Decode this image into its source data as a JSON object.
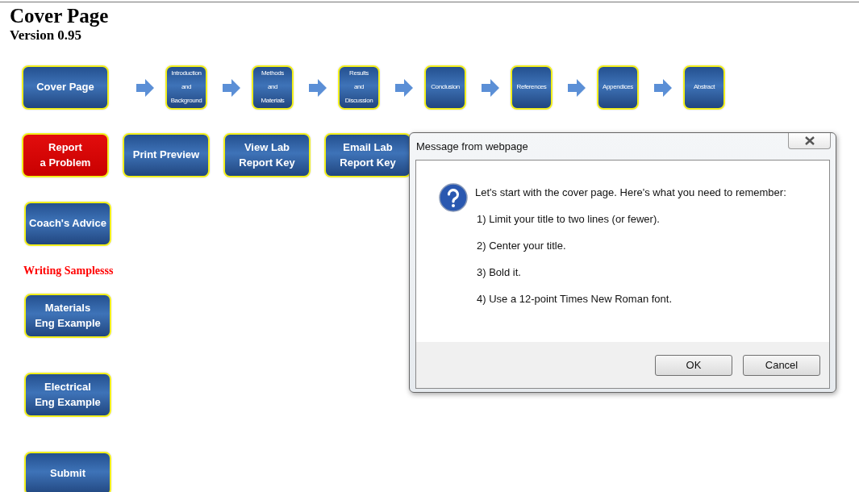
{
  "header": {
    "title": "Cover Page",
    "version": "Version 0.95"
  },
  "steps": [
    {
      "kind": "large",
      "lines": [
        "Cover Page"
      ]
    },
    {
      "kind": "small",
      "lines": [
        "Introduction",
        "and",
        "Background"
      ]
    },
    {
      "kind": "small",
      "lines": [
        "Methods",
        "and",
        "Materials"
      ]
    },
    {
      "kind": "small",
      "lines": [
        "Results",
        "and",
        "Discussion"
      ]
    },
    {
      "kind": "small",
      "lines": [
        "Conclusion"
      ]
    },
    {
      "kind": "small",
      "lines": [
        "References"
      ]
    },
    {
      "kind": "small",
      "lines": [
        "Appendices"
      ]
    },
    {
      "kind": "small",
      "lines": [
        "Abstract"
      ]
    }
  ],
  "actions": [
    {
      "kind": "alert",
      "lines": [
        "Report",
        "a Problem"
      ]
    },
    {
      "kind": "normal",
      "lines": [
        "Print Preview"
      ]
    },
    {
      "kind": "normal",
      "lines": [
        "View Lab",
        "Report Key"
      ]
    },
    {
      "kind": "normal",
      "lines": [
        "Email Lab",
        "Report Key"
      ]
    }
  ],
  "sidebar": [
    {
      "kind": "button",
      "lines": [
        "Coach's Advice"
      ]
    },
    {
      "kind": "heading",
      "lines": [
        "Writing Samplesss"
      ]
    },
    {
      "kind": "button",
      "lines": [
        "Materials",
        "Eng Example"
      ]
    },
    {
      "kind": "button",
      "lines": [
        "Electrical",
        "Eng Example"
      ]
    },
    {
      "kind": "button",
      "lines": [
        "Submit"
      ]
    }
  ],
  "dialog": {
    "title": "Message from webpage",
    "message": "Let's start with the cover page. Here's what you need to remember:",
    "items": [
      "1) Limit your title to two lines (or fewer).",
      "2) Center your title.",
      "3) Bold it.",
      "4) Use a 12-point Times New Roman font."
    ],
    "buttons": [
      "OK",
      "Cancel"
    ]
  }
}
